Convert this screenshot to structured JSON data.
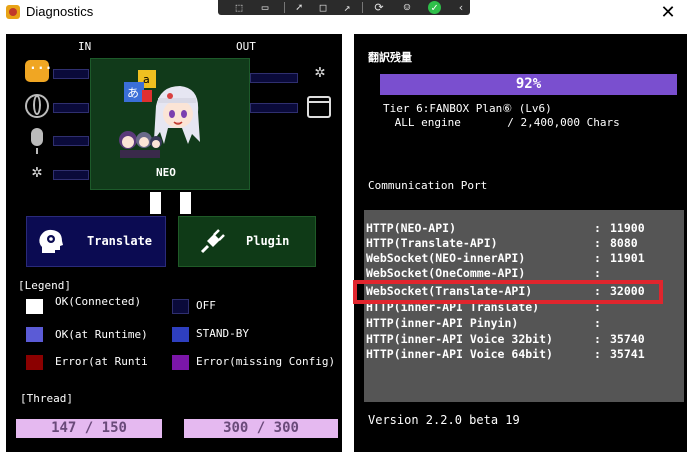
{
  "window": {
    "title": "Diagnostics",
    "close_glyph": "✕"
  },
  "overlay_toolbar": {
    "icons": [
      "region-select-icon",
      "video-icon",
      "pointer-icon",
      "window-icon",
      "snip-icon",
      "sync-icon",
      "accessibility-icon",
      "check-icon",
      "chevron-left-icon"
    ]
  },
  "left": {
    "in_label": "IN",
    "out_label": "OUT",
    "neo_label": "NEO",
    "translate_label": "Translate",
    "plugin_label": "Plugin",
    "legend_title": "[Legend]",
    "legend": [
      {
        "label": "OK(Connected)",
        "color": "#ffffff"
      },
      {
        "label": "OFF",
        "color": "#0a0a3a"
      },
      {
        "label": "OK(at Runtime)",
        "color": "#5b5bd6"
      },
      {
        "label": "STAND-BY",
        "color": "#2e3fbf"
      },
      {
        "label": "Error(at Runtime",
        "color": "#8b0000"
      },
      {
        "label": "Error(missing Config)",
        "color": "#7b16a8"
      }
    ],
    "thread_title": "[Thread]",
    "thread": [
      "147 / 150",
      "300 / 300"
    ],
    "colors": {
      "neo_green": "#113a1a",
      "translate_navy": "#0b0b52",
      "plugin_green": "#0f3a17",
      "thread_bar": "#e5b9f0"
    }
  },
  "right": {
    "remain_title": "翻訳残量",
    "remain_percent": "92%",
    "remain_fraction": 0.92,
    "tier_line": "Tier 6:FANBOX Plan⑥ (Lv6)",
    "engine_line": " ALL engine       / 2,400,000 Chars",
    "comm_title": "Communication Port",
    "ports": [
      {
        "name": "HTTP(NEO-API)",
        "port": "11900"
      },
      {
        "name": "HTTP(Translate-API)",
        "port": "8080"
      },
      {
        "name": "WebSocket(NEO-innerAPI)",
        "port": "11901"
      },
      {
        "name": "WebSocket(OneComme-API)",
        "port": ""
      },
      {
        "name": "WebSocket(Translate-API)",
        "port": "32000"
      },
      {
        "name": "HTTP(inner-API Translate)",
        "port": ""
      },
      {
        "name": "HTTP(inner-API Pinyin)",
        "port": ""
      },
      {
        "name": "HTTP(inner-API Voice 32bit)",
        "port": "35740"
      },
      {
        "name": "HTTP(inner-API Voice 64bit)",
        "port": "35741"
      }
    ],
    "highlighted_port_index": 4,
    "version": "Version 2.2.0 beta 19",
    "colors": {
      "remain_bar": "#7a4fcf",
      "highlight": "#e0252d",
      "port_panel": "#555555"
    }
  }
}
